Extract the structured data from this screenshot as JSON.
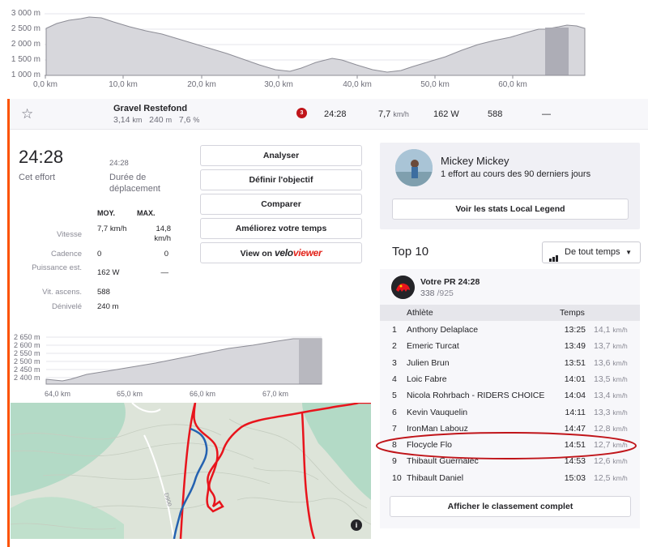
{
  "top_chart": {
    "y_ticks": [
      "3 000 m",
      "2 500 m",
      "2 000 m",
      "1 500 m",
      "1 000 m"
    ],
    "x_ticks": [
      "0,0 km",
      "10,0 km",
      "20,0 km",
      "30,0 km",
      "40,0 km",
      "50,0 km",
      "60,0 km"
    ]
  },
  "segment": {
    "name": "Gravel Restefond",
    "distance": "3,14",
    "distance_unit": "km",
    "elev_gain": "240",
    "elev_unit": "m",
    "grade": "7,6",
    "grade_unit": "%",
    "rank_badge": "3",
    "time": "24:28",
    "speed": "7,7",
    "speed_unit": "km/h",
    "power": "162 W",
    "heartrate": "588",
    "extra": "—"
  },
  "effort": {
    "elapsed_time": "24:28",
    "elapsed_label": "Cet effort",
    "moving_time": "24:28",
    "moving_label": "Durée de déplacement",
    "headers": {
      "avg": "MOY.",
      "max": "MAX."
    },
    "rows": [
      {
        "label": "Vitesse",
        "avg": "7,7 km/h",
        "max": "14,8 km/h"
      },
      {
        "label": "Cadence",
        "avg": "0",
        "max": "0"
      },
      {
        "label": "Puissance est.",
        "avg": "162 W",
        "max": "—"
      },
      {
        "label": "Vit. ascens.",
        "avg": "588",
        "max": ""
      },
      {
        "label": "Dénivelé",
        "avg": "240 m",
        "max": ""
      }
    ]
  },
  "actions": {
    "analyze": "Analyser",
    "set_goal": "Définir l'objectif",
    "compare": "Comparer",
    "improve": "Améliorez votre temps",
    "view_on": "View on",
    "veloviewer_a": "velo",
    "veloviewer_b": "viewer"
  },
  "small_chart": {
    "y_ticks": [
      "2 650 m",
      "2 600 m",
      "2 550 m",
      "2 500 m",
      "2 450 m",
      "2 400 m"
    ],
    "x_ticks": [
      "64,0 km",
      "65,0 km",
      "66,0 km",
      "67,0 km"
    ]
  },
  "map": {
    "info_icon": "i",
    "road_label": "D900"
  },
  "local_legend": {
    "name": "Mickey Mickey",
    "description": "1 effort au cours des 90 derniers jours",
    "button": "Voir les stats Local Legend"
  },
  "leaderboard": {
    "title": "Top 10",
    "filter": "De tout temps",
    "pr_title": "Votre PR 24:28",
    "pr_rank": "338",
    "pr_total": "/925",
    "col_athlete": "Athlète",
    "col_time": "Temps",
    "rows": [
      {
        "rank": "1",
        "athlete": "Anthony Delaplace",
        "time": "13:25",
        "speed": "14,1",
        "unit": "km/h"
      },
      {
        "rank": "2",
        "athlete": "Emeric Turcat",
        "time": "13:49",
        "speed": "13,7",
        "unit": "km/h"
      },
      {
        "rank": "3",
        "athlete": "Julien Brun",
        "time": "13:51",
        "speed": "13,6",
        "unit": "km/h"
      },
      {
        "rank": "4",
        "athlete": "Loic Fabre",
        "time": "14:01",
        "speed": "13,5",
        "unit": "km/h"
      },
      {
        "rank": "5",
        "athlete": "Nicola Rohrbach - RIDERS CHOICE",
        "time": "14:04",
        "speed": "13,4",
        "unit": "km/h"
      },
      {
        "rank": "6",
        "athlete": "Kevin Vauquelin",
        "time": "14:11",
        "speed": "13,3",
        "unit": "km/h"
      },
      {
        "rank": "7",
        "athlete": "IronMan Labouz",
        "time": "14:47",
        "speed": "12,8",
        "unit": "km/h"
      },
      {
        "rank": "8",
        "athlete": "Flocycle Flo",
        "time": "14:51",
        "speed": "12,7",
        "unit": "km/h"
      },
      {
        "rank": "9",
        "athlete": "Thibault Guernalec",
        "time": "14:53",
        "speed": "12,6",
        "unit": "km/h"
      },
      {
        "rank": "10",
        "athlete": "Thibault Daniel",
        "time": "15:03",
        "speed": "12,5",
        "unit": "km/h"
      }
    ],
    "full_button": "Afficher le classement complet"
  },
  "colors": {
    "accent": "#fc5200",
    "annotation": "#c0151a",
    "route_red": "#e8141c",
    "route_blue": "#2462b0"
  }
}
